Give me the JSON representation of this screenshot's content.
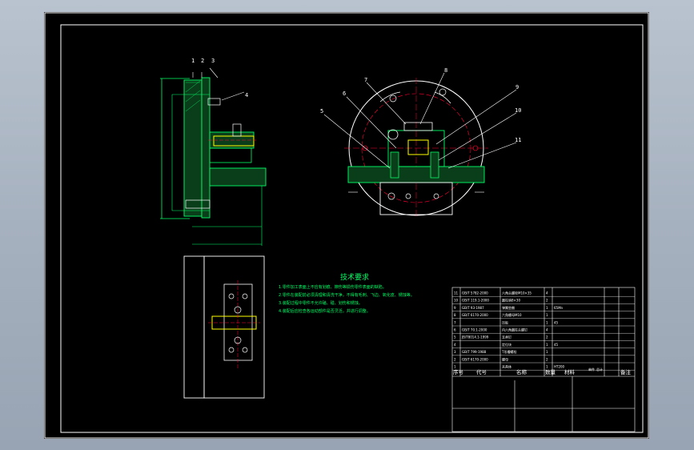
{
  "drawing": {
    "tech_title": "技术要求",
    "tech_notes": [
      "1.零件加工表面上不应有划痕、擦伤等损伤零件表面的缺陷。",
      "2.零件在装配前必须清理和清洗干净，不得有毛刺、飞边、氧化皮、锈蚀等。",
      "3.装配过程中零件不允许磕、碰、划伤和锈蚀。",
      "4.装配后应检查各运动部件是否灵活，并进行调整。"
    ],
    "part_balloons": [
      "1",
      "2",
      "3",
      "4",
      "5",
      "6",
      "7",
      "8",
      "9",
      "10",
      "11"
    ]
  },
  "title_block": {
    "headers": {
      "no": "序号",
      "code": "代号",
      "name": "名称",
      "qty": "数量",
      "material": "材料",
      "unit_wt": "单件",
      "total_wt": "总计",
      "remarks": "备注"
    },
    "rows": [
      {
        "no": "11",
        "code": "GB/T 5782-2000",
        "name": "六角头螺栓M10×35",
        "qty": "4",
        "material": "",
        "remarks": ""
      },
      {
        "no": "10",
        "code": "GB/T 119.1-2000",
        "name": "圆柱销8×30",
        "qty": "2",
        "material": "",
        "remarks": ""
      },
      {
        "no": "9",
        "code": "GB/T 93-1987",
        "name": "弹簧垫圈",
        "qty": "1",
        "material": "65Mn",
        "remarks": ""
      },
      {
        "no": "8",
        "code": "GB/T 6170-2000",
        "name": "六角螺母M10",
        "qty": "1",
        "material": "",
        "remarks": ""
      },
      {
        "no": "7",
        "code": "",
        "name": "压板",
        "qty": "1",
        "material": "45",
        "remarks": ""
      },
      {
        "no": "6",
        "code": "GB/T 70.1-2000",
        "name": "内六角圆柱头螺钉",
        "qty": "4",
        "material": "",
        "remarks": ""
      },
      {
        "no": "5",
        "code": "JB/T8014.1-1999",
        "name": "支承钉",
        "qty": "2",
        "material": "",
        "remarks": ""
      },
      {
        "no": "4",
        "code": "",
        "name": "定位块",
        "qty": "1",
        "material": "45",
        "remarks": ""
      },
      {
        "no": "3",
        "code": "GB/T 799-1988",
        "name": "T形槽螺栓",
        "qty": "1",
        "material": "",
        "remarks": ""
      },
      {
        "no": "2",
        "code": "GB/T 6170-2000",
        "name": "螺母",
        "qty": "2",
        "material": "",
        "remarks": ""
      },
      {
        "no": "1",
        "code": "",
        "name": "夹具体",
        "qty": "1",
        "material": "HT200",
        "remarks": ""
      }
    ]
  },
  "colors": {
    "sheet": "#000000",
    "outline": "#ffffff",
    "part": "#00ff66",
    "center": "#ff0033",
    "hatch": "#00ff66",
    "bolt": "#ffff00",
    "dim": "#00ff66",
    "balloon": "#ffffff"
  }
}
